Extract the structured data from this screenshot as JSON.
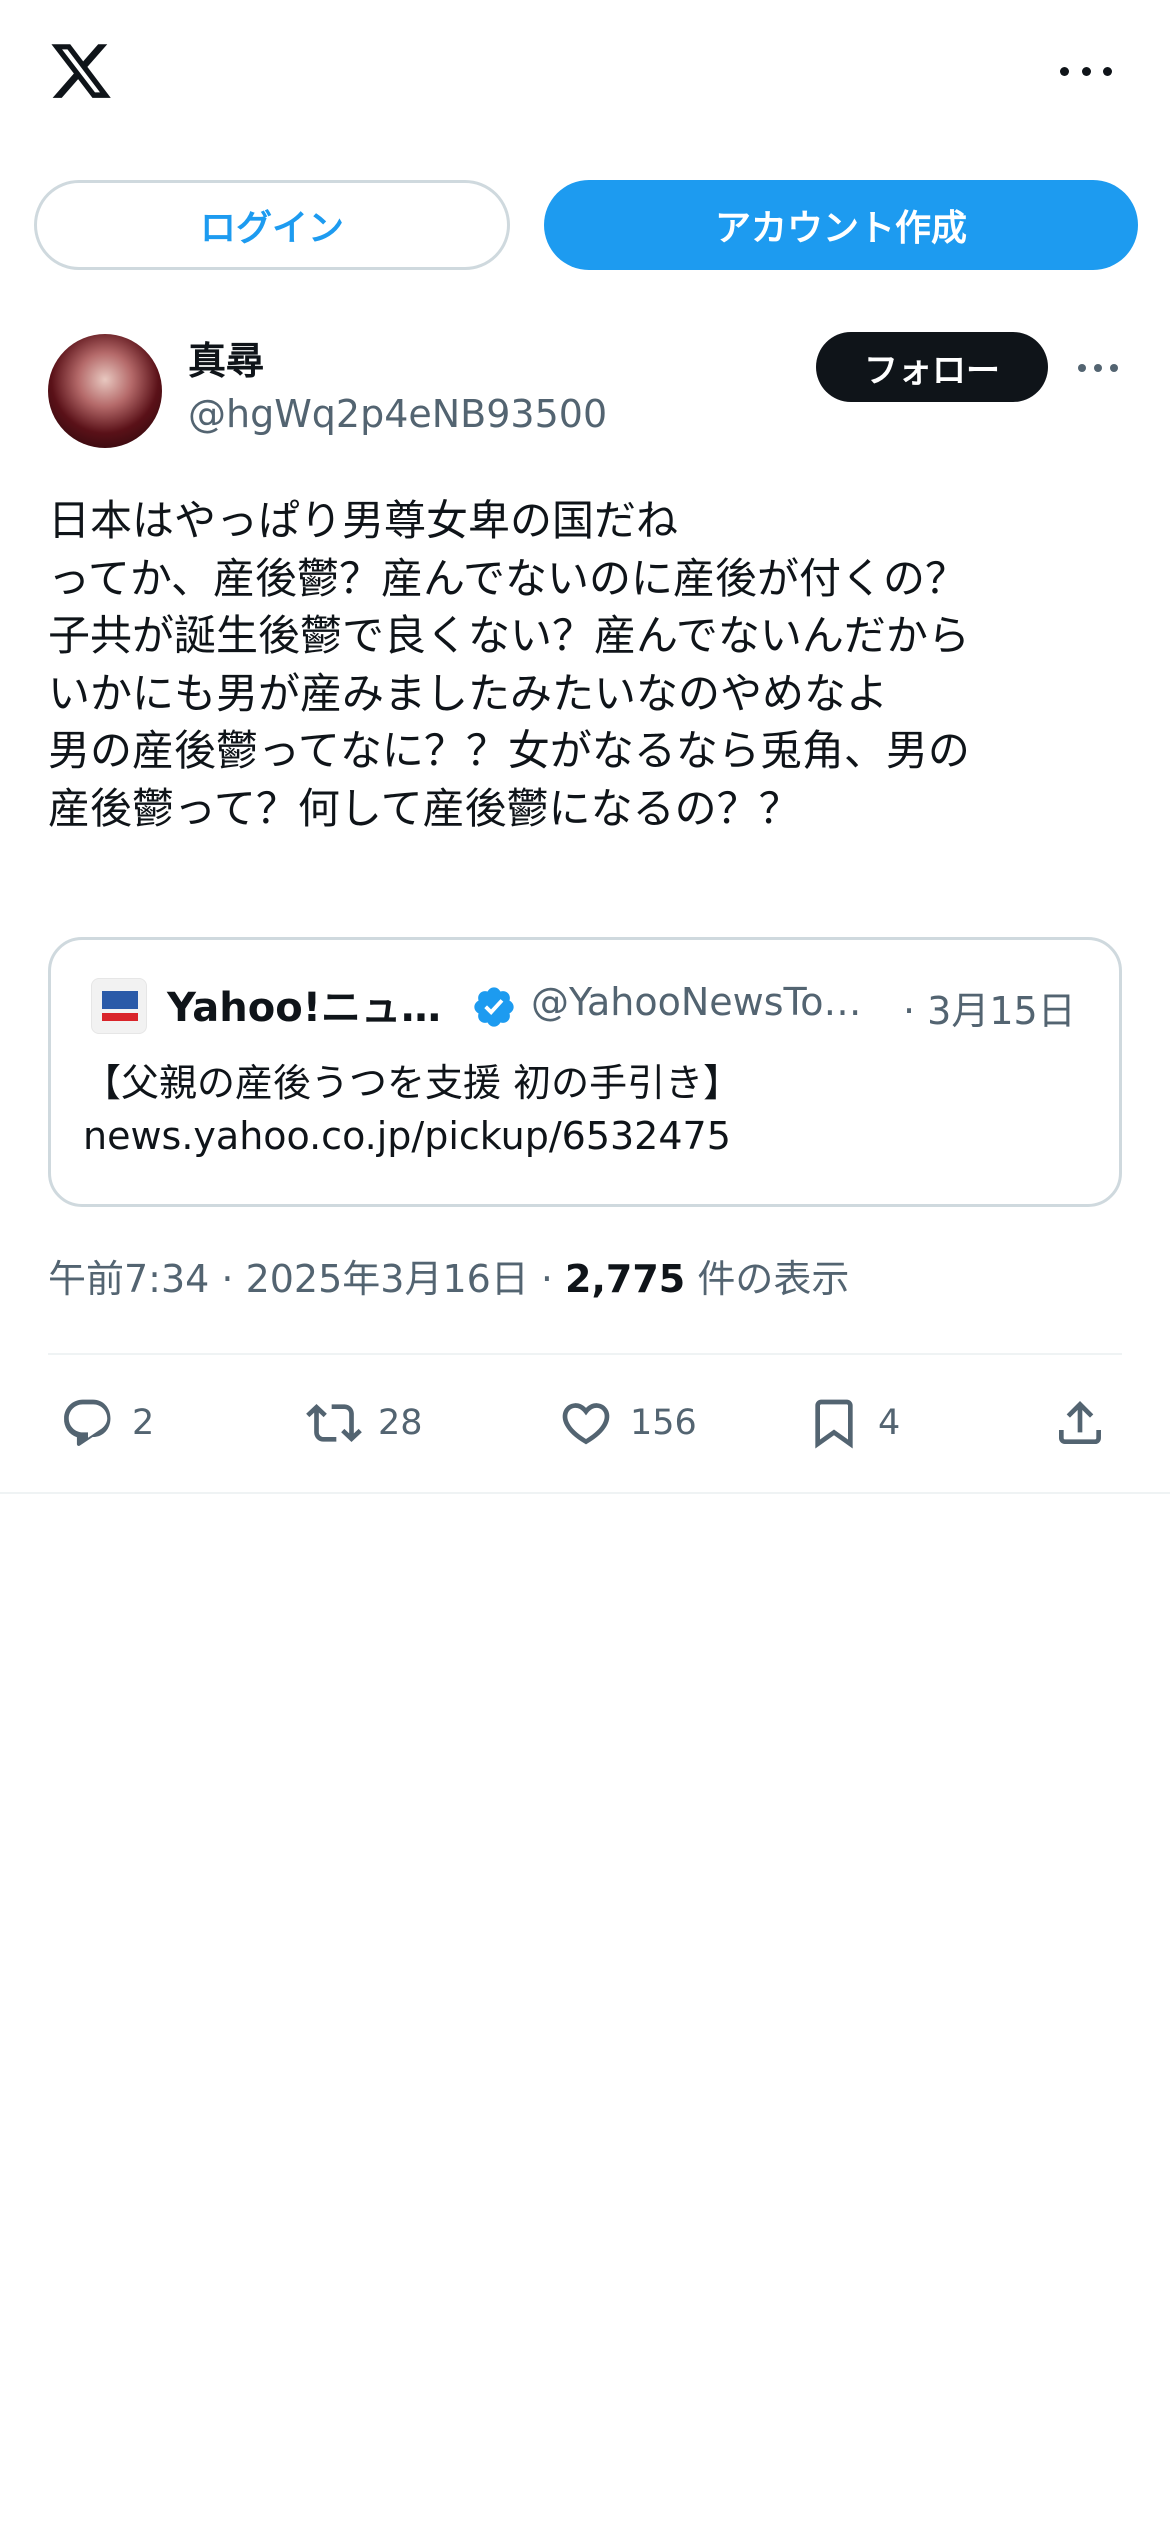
{
  "header": {
    "logo_icon": "x-logo-icon",
    "more_icon": "more-icon"
  },
  "auth": {
    "login_label": "ログイン",
    "signup_label": "アカウント作成"
  },
  "tweet": {
    "display_name": "真尋",
    "handle": "@hgWq2p4eNB93500",
    "follow_label": "フォロー",
    "text": "日本はやっぱり男尊女卑の国だね\nってか、産後鬱？産んでないのに産後が付くの？\n子共が誕生後鬱で良くない？産んでないんだから\nいかにも男が産みましたみたいなのやめなよ\n男の産後鬱ってなに？？女がなるなら兎角、男の\n産後鬱って？何して産後鬱になるの？？",
    "quote": {
      "name": "Yahoo!ニュ…",
      "handle": "@YahooNewsTo…",
      "date": "· 3月15日",
      "text": "【父親の産後うつを支援 初の手引き】",
      "url": "news.yahoo.co.jp/pickup/6532475"
    },
    "meta": {
      "time_date": "午前7:34 · 2025年3月16日 · ",
      "views_count": "2,775",
      "views_label": " 件の表示"
    },
    "actions": {
      "replies": "2",
      "retweets": "28",
      "likes": "156",
      "bookmarks": "4"
    }
  },
  "colors": {
    "accent": "#1d9bf0",
    "text": "#0f1419",
    "secondary": "#536471",
    "border": "#cfd9de"
  }
}
